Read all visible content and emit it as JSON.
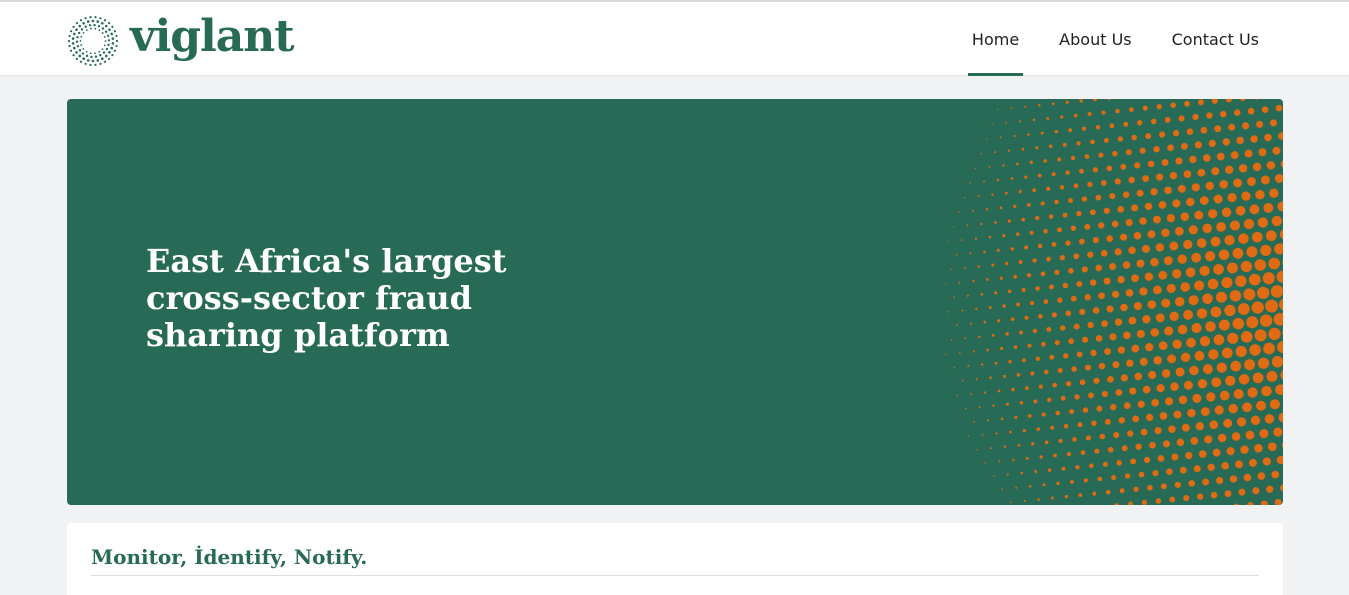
{
  "header": {
    "brand": "viglant",
    "nav": [
      {
        "label": "Home",
        "active": true
      },
      {
        "label": "About Us",
        "active": false
      },
      {
        "label": "Contact Us",
        "active": false
      }
    ]
  },
  "hero": {
    "headline": "East Africa's largest cross-sector fraud sharing platform"
  },
  "section": {
    "title": "Monitor, İdentify, Notify."
  },
  "colors": {
    "brand_green": "#276a55",
    "accent_orange": "#e06b12",
    "page_background": "#f1f2f4"
  },
  "icons": {
    "logo": "dotted-ring-logo-icon"
  }
}
